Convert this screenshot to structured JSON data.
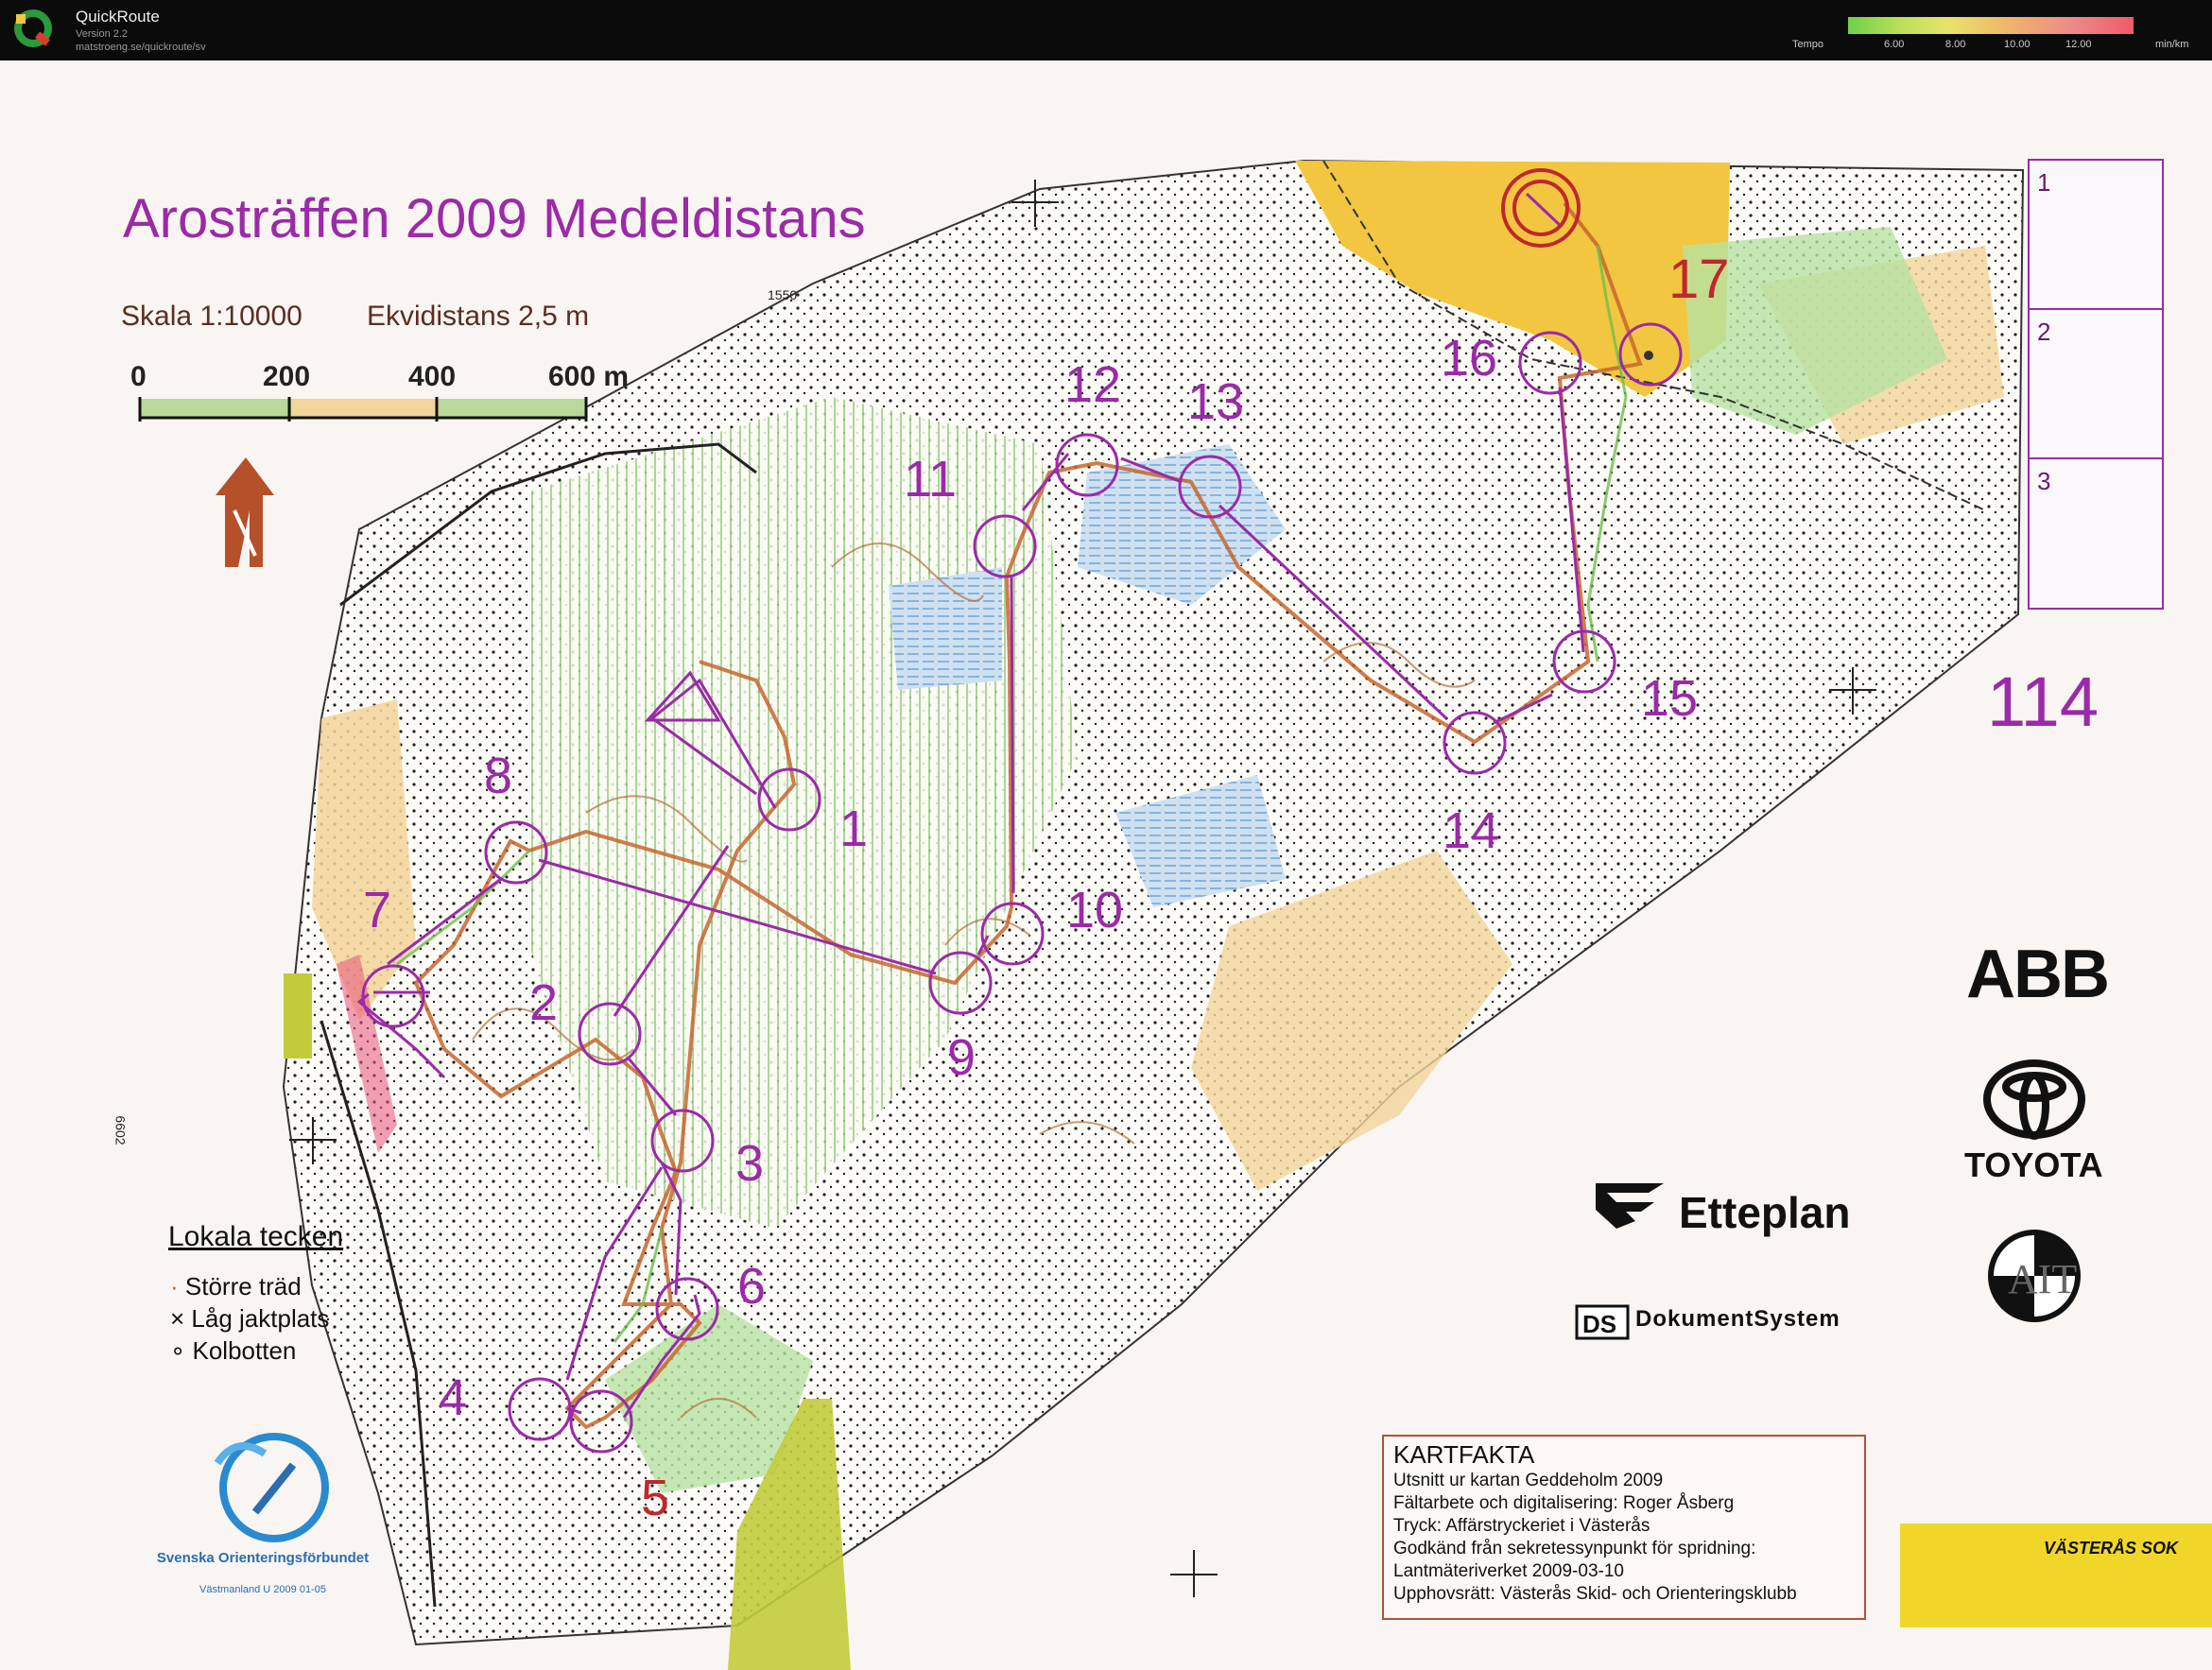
{
  "app": {
    "name": "QuickRoute",
    "version": "Version 2.2",
    "url": "matstroeng.se/quickroute/sv"
  },
  "tempo": {
    "label": "Tempo",
    "ticks": [
      "6.00",
      "8.00",
      "10.00",
      "12.00"
    ],
    "unit": "min/km"
  },
  "map": {
    "title": "Arosträffen 2009  Medeldistans",
    "scale": "Skala 1:10000",
    "equidistance": "Ekvidistans 2,5 m",
    "scalebar_labels": [
      "0",
      "200",
      "400",
      "600 m"
    ],
    "course_number": "114",
    "grid_labels": [
      "1550",
      "6602"
    ]
  },
  "controls": [
    {
      "num": "1"
    },
    {
      "num": "2"
    },
    {
      "num": "3"
    },
    {
      "num": "4"
    },
    {
      "num": "5"
    },
    {
      "num": "6"
    },
    {
      "num": "7"
    },
    {
      "num": "8"
    },
    {
      "num": "9"
    },
    {
      "num": "10"
    },
    {
      "num": "11"
    },
    {
      "num": "12"
    },
    {
      "num": "13"
    },
    {
      "num": "14"
    },
    {
      "num": "15"
    },
    {
      "num": "16"
    },
    {
      "num": "17"
    }
  ],
  "description_box": [
    "1",
    "2",
    "3"
  ],
  "legend": {
    "title": "Lokala tecken",
    "items": [
      "Större träd",
      "Låg jaktplats",
      "Kolbotten"
    ]
  },
  "kartfakta": {
    "title": "KARTFAKTA",
    "lines": [
      "Utsnitt ur kartan Geddeholm 2009",
      "Fältarbete och digitalisering: Roger Åsberg",
      "Tryck: Affärstryckeriet i Västerås",
      "Godkänd från sekretessynpunkt för spridning:",
      "Lantmäteriverket  2009-03-10",
      "Upphovsrätt: Västerås Skid- och Orienteringsklubb"
    ]
  },
  "sponsors": {
    "abb": "ABB",
    "toyota": "TOYOTA",
    "etteplan": "Etteplan",
    "dokumentsystem": "DokumentSystem",
    "vasteras_sok": "VÄSTERÅS SOK",
    "sof": "Svenska Orienteringsförbundet",
    "sof_sub": "Västmanland U 2009 01-05"
  },
  "colors": {
    "course": "#9b2aa8",
    "route": "#c7662e",
    "start": "#c0272d",
    "open_land": "#f2c640",
    "forest_green": "#8fd27a",
    "marsh_blue": "#7ab0e0"
  }
}
